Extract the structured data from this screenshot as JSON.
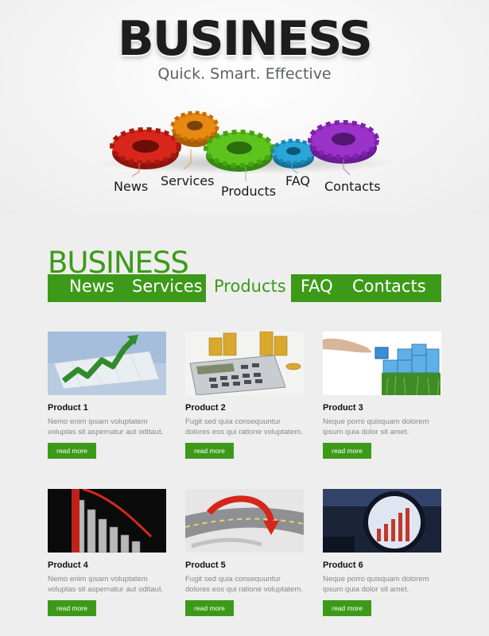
{
  "hero": {
    "title": "BUSINESS",
    "tagline": "Quick. Smart. Effective",
    "gear_labels": [
      "News",
      "Services",
      "Products",
      "FAQ",
      "Contacts"
    ]
  },
  "menu": {
    "brand": "BUSINESS",
    "items": [
      "News",
      "Services",
      "Products",
      "FAQ",
      "Contacts"
    ],
    "active": "Products"
  },
  "products": [
    {
      "title": "Product 1",
      "desc": "Nemo enim ipsam voluptatem voluptas sit aspernatur aut oditaut.",
      "button": "read more",
      "image": "growth-chart-icon"
    },
    {
      "title": "Product 2",
      "desc": "Fugit sed quia consequuntur dolores eos qui ratione voluptatem.",
      "button": "read more",
      "image": "calculator-coins-icon"
    },
    {
      "title": "Product 3",
      "desc": "Neque porro quisquam dolorem ipsum quia dolor sit amet.",
      "button": "read more",
      "image": "cubes-hand-icon"
    },
    {
      "title": "Product 4",
      "desc": "Nemo enim ipsam voluptatem voluptas sit aspernatur aut oditaut.",
      "button": "read more",
      "image": "falling-graph-icon"
    },
    {
      "title": "Product 5",
      "desc": "Fugit sed quia consequuntur dolores eos qui ratione voluptatem.",
      "button": "read more",
      "image": "arrow-road-icon"
    },
    {
      "title": "Product 6",
      "desc": "Neque porro quisquam dolorem ipsum quia dolor sit amet.",
      "button": "read more",
      "image": "magnified-chart-icon"
    }
  ],
  "colors": {
    "accent": "#3d9a19",
    "background": "#eeeeee",
    "gear_red": "#d9261c",
    "gear_orange": "#e88a12",
    "gear_green": "#5dc41d",
    "gear_blue": "#2aa7d8",
    "gear_purple": "#9b33c9"
  }
}
